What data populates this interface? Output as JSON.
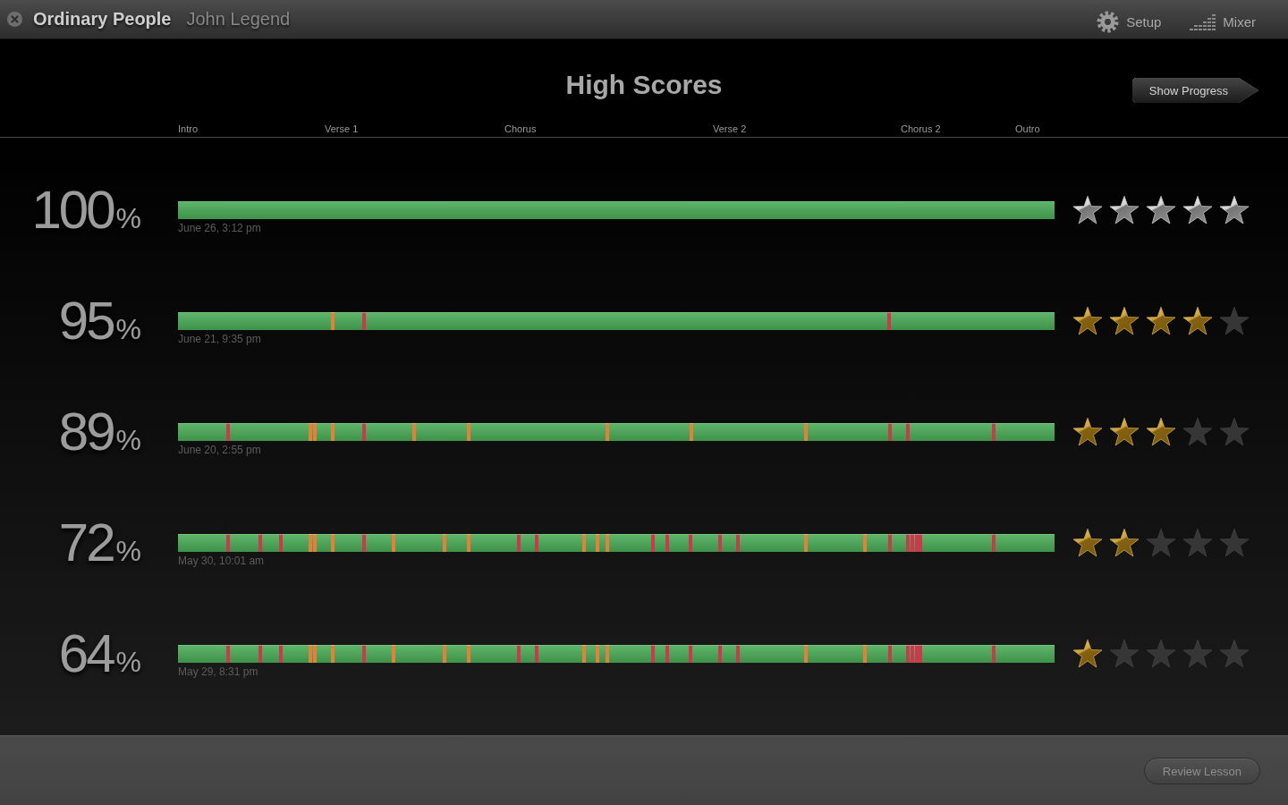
{
  "title_bar": {
    "song_title": "Ordinary People",
    "artist": "John Legend",
    "buttons": [
      {
        "kind": "setup",
        "label": "Setup"
      },
      {
        "kind": "mixer",
        "label": "Mixer"
      }
    ]
  },
  "header": {
    "title": "High Scores",
    "show_progress_button": "Show Progress",
    "sections": [
      "Intro",
      "Verse 1",
      "Chorus",
      "Verse 2",
      "Chorus 2",
      "Outro"
    ]
  },
  "rows": [
    {
      "kind": "perfect",
      "score": "100",
      "percent_sign": "%",
      "date": "June 26, 3:12 pm",
      "stars": 5
    },
    {
      "kind": "scored",
      "score": "95",
      "percent_sign": "%",
      "marks": [
        {
          "level": 0.177,
          "color": "#e3803a"
        },
        {
          "level": 0.212,
          "color": "#c93a4c"
        },
        {
          "level": 0.811,
          "color": "#c93a4c"
        }
      ],
      "date": "June 21, 9:35 pm",
      "stars": 4
    },
    {
      "kind": "scored",
      "score": "89",
      "percent_sign": "%",
      "marks": [
        {
          "level": 0.057,
          "color": "#c93a4c"
        },
        {
          "level": 0.151,
          "color": "#e3803a"
        },
        {
          "level": 0.156,
          "color": "#e3803a"
        },
        {
          "level": 0.177,
          "color": "#e3803a"
        },
        {
          "level": 0.212,
          "color": "#c93a4c"
        },
        {
          "level": 0.269,
          "color": "#e3803a"
        },
        {
          "level": 0.332,
          "color": "#e3803a"
        },
        {
          "level": 0.49,
          "color": "#e3803a"
        },
        {
          "level": 0.586,
          "color": "#e3803a"
        },
        {
          "level": 0.716,
          "color": "#e3803a"
        },
        {
          "level": 0.812,
          "color": "#c93a4c"
        },
        {
          "level": 0.833,
          "color": "#c93a4c"
        },
        {
          "level": 0.931,
          "color": "#c93a4c"
        }
      ],
      "date": "June 20, 2:55 pm",
      "stars": 3
    },
    {
      "kind": "scored",
      "score": "72",
      "percent_sign": "%",
      "marks": [
        {
          "level": 0.057,
          "color": "#c93a4c"
        },
        {
          "level": 0.094,
          "color": "#c93a4c"
        },
        {
          "level": 0.117,
          "color": "#c93a4c"
        },
        {
          "level": 0.151,
          "color": "#e3803a"
        },
        {
          "level": 0.156,
          "color": "#e3803a"
        },
        {
          "level": 0.177,
          "color": "#e3803a"
        },
        {
          "level": 0.212,
          "color": "#c93a4c"
        },
        {
          "level": 0.246,
          "color": "#e3803a"
        },
        {
          "level": 0.304,
          "color": "#e3803a"
        },
        {
          "level": 0.332,
          "color": "#e3803a"
        },
        {
          "level": 0.389,
          "color": "#c93a4c"
        },
        {
          "level": 0.409,
          "color": "#c93a4c"
        },
        {
          "level": 0.463,
          "color": "#e3803a"
        },
        {
          "level": 0.479,
          "color": "#e3803a"
        },
        {
          "level": 0.49,
          "color": "#e3803a"
        },
        {
          "level": 0.542,
          "color": "#c93a4c"
        },
        {
          "level": 0.558,
          "color": "#c93a4c"
        },
        {
          "level": 0.585,
          "color": "#c93a4c"
        },
        {
          "level": 0.618,
          "color": "#c93a4c"
        },
        {
          "level": 0.639,
          "color": "#c93a4c"
        },
        {
          "level": 0.716,
          "color": "#e3803a"
        },
        {
          "level": 0.784,
          "color": "#e3803a"
        },
        {
          "level": 0.812,
          "color": "#c93a4c"
        },
        {
          "level": 0.833,
          "color": "#c93a4c"
        },
        {
          "level": 0.838,
          "color": "#c93a4c"
        },
        {
          "level": 0.843,
          "color": "#c93a4c"
        },
        {
          "level": 0.847,
          "color": "#c93a4c"
        },
        {
          "level": 0.931,
          "color": "#c93a4c"
        }
      ],
      "date": "May 30, 10:01 am",
      "stars": 2
    },
    {
      "kind": "scored",
      "score": "64",
      "percent_sign": "%",
      "marks": [
        {
          "level": 0.057,
          "color": "#c93a4c"
        },
        {
          "level": 0.094,
          "color": "#c93a4c"
        },
        {
          "level": 0.117,
          "color": "#c93a4c"
        },
        {
          "level": 0.151,
          "color": "#e3803a"
        },
        {
          "level": 0.156,
          "color": "#e3803a"
        },
        {
          "level": 0.177,
          "color": "#e3803a"
        },
        {
          "level": 0.212,
          "color": "#c93a4c"
        },
        {
          "level": 0.246,
          "color": "#e3803a"
        },
        {
          "level": 0.304,
          "color": "#e3803a"
        },
        {
          "level": 0.332,
          "color": "#e3803a"
        },
        {
          "level": 0.389,
          "color": "#c93a4c"
        },
        {
          "level": 0.409,
          "color": "#c93a4c"
        },
        {
          "level": 0.463,
          "color": "#e3803a"
        },
        {
          "level": 0.479,
          "color": "#e3803a"
        },
        {
          "level": 0.49,
          "color": "#e3803a"
        },
        {
          "level": 0.542,
          "color": "#c93a4c"
        },
        {
          "level": 0.558,
          "color": "#c93a4c"
        },
        {
          "level": 0.585,
          "color": "#c93a4c"
        },
        {
          "level": 0.618,
          "color": "#c93a4c"
        },
        {
          "level": 0.639,
          "color": "#c93a4c"
        },
        {
          "level": 0.716,
          "color": "#e3803a"
        },
        {
          "level": 0.784,
          "color": "#e3803a"
        },
        {
          "level": 0.812,
          "color": "#c93a4c"
        },
        {
          "level": 0.833,
          "color": "#c93a4c"
        },
        {
          "level": 0.838,
          "color": "#c93a4c"
        },
        {
          "level": 0.843,
          "color": "#c93a4c"
        },
        {
          "level": 0.847,
          "color": "#c93a4c"
        },
        {
          "level": 0.931,
          "color": "#c93a4c"
        }
      ],
      "date": "May 29, 8:31 pm",
      "stars": 1
    }
  ],
  "footer": {
    "review_button": "Review Lesson"
  }
}
